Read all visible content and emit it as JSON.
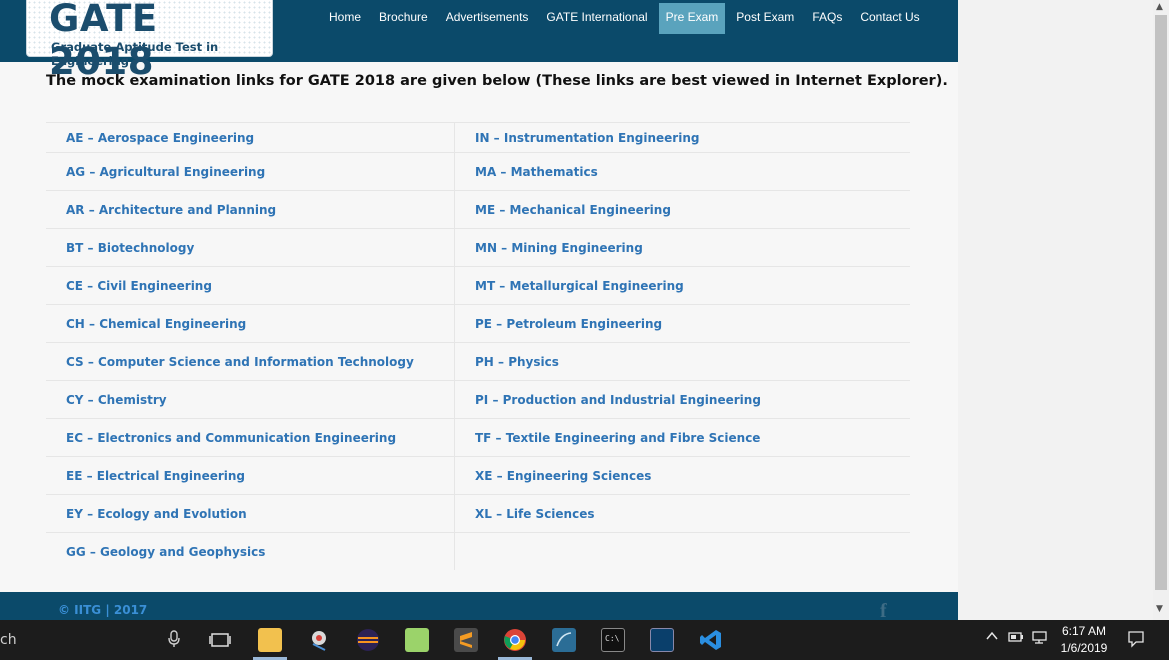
{
  "header": {
    "logo_title": "GATE 2018",
    "logo_subtitle": "Graduate Aptitude Test in Engineering",
    "nav": [
      "Home",
      "Brochure",
      "Advertisements",
      "GATE International",
      "Pre Exam",
      "Post Exam",
      "FAQs",
      "Contact Us"
    ],
    "active_nav": "Pre Exam"
  },
  "intro": "The mock examination links for GATE 2018 are given below (These links are best viewed in Internet Explorer).",
  "links": {
    "left": [
      "AE – Aerospace Engineering",
      "AG – Agricultural Engineering",
      "AR – Architecture and Planning",
      "BT – Biotechnology",
      "CE – Civil Engineering",
      "CH – Chemical Engineering",
      "CS – Computer Science and Information Technology",
      "CY – Chemistry",
      "EC – Electronics and Communication Engineering",
      "EE – Electrical Engineering",
      "EY – Ecology and Evolution",
      "GG – Geology and Geophysics"
    ],
    "right": [
      "IN – Instrumentation Engineering",
      "MA – Mathematics",
      "ME – Mechanical Engineering",
      "MN – Mining Engineering",
      "MT – Metallurgical Engineering",
      "PE – Petroleum Engineering",
      "PH – Physics",
      "PI – Production and Industrial Engineering",
      "TF – Textile Engineering and Fibre Science",
      "XE – Engineering Sciences",
      "XL – Life Sciences",
      ""
    ]
  },
  "footer": {
    "copyright": "© IITG | 2017",
    "social_icon": "facebook-icon",
    "social_glyph": "f"
  },
  "taskbar": {
    "search_fragment": "ch",
    "apps": [
      "task-view",
      "file-explorer",
      "snipping-tool",
      "eclipse",
      "notepad-plus-plus",
      "sublime-text",
      "chrome",
      "mysql-workbench",
      "command-prompt",
      "mysql-shell",
      "vs-code"
    ],
    "time": "6:17 AM",
    "date": "1/6/2019"
  },
  "colors": {
    "header_bg": "#0b4a6a",
    "nav_active": "#5aa3bd",
    "link": "#2f74b5",
    "copyright": "#3a8fd6"
  }
}
